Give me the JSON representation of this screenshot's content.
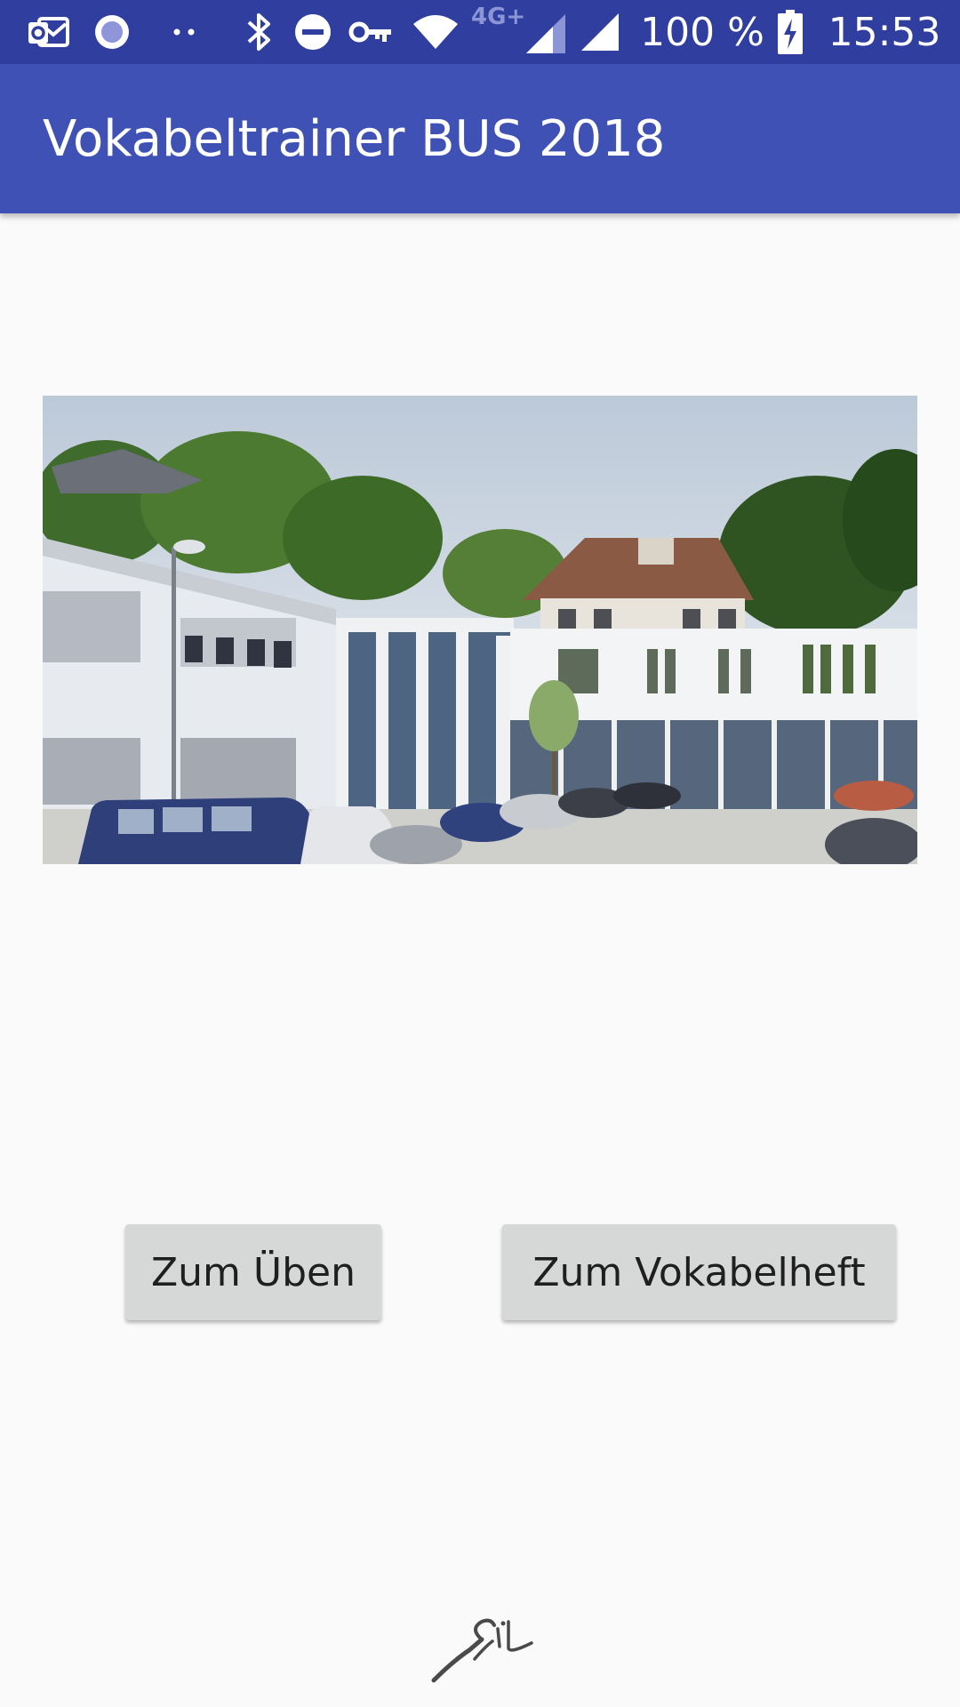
{
  "statusbar": {
    "network_type": "4G+",
    "battery_percent": "100 %",
    "time": "15:53",
    "icons": [
      "outlook-icon",
      "record-icon",
      "more-dots-icon",
      "bluetooth-icon",
      "do-not-disturb-icon",
      "vpn-key-icon",
      "wifi-icon",
      "signal-icon",
      "signal-full-icon",
      "battery-charging-icon"
    ]
  },
  "appbar": {
    "title": "Vokabeltrainer BUS 2018"
  },
  "main": {
    "practice_button_label": "Zum Üben",
    "vocab_button_label": "Zum Vokabelheft"
  },
  "colors": {
    "statusbar": "#303f9f",
    "appbar": "#3f51b5",
    "background": "#fafafa",
    "button": "#d6d7d7"
  }
}
